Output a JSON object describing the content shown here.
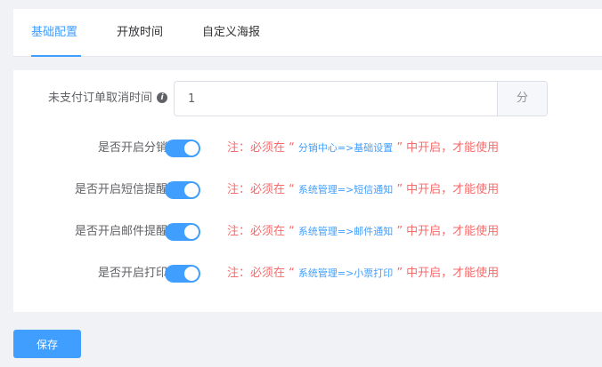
{
  "tabs": [
    {
      "label": "基础配置",
      "active": true
    },
    {
      "label": "开放时间",
      "active": false
    },
    {
      "label": "自定义海报",
      "active": false
    }
  ],
  "order_cancel": {
    "label": "未支付订单取消时间",
    "value": "1",
    "unit": "分"
  },
  "switches": [
    {
      "label": "是否开启分销",
      "on": true,
      "note_prefix": "注：必须在 “",
      "note_path": "分销中心=>基础设置",
      "note_suffix": "” 中开启，才能使用"
    },
    {
      "label": "是否开启短信提醒",
      "on": true,
      "note_prefix": "注：必须在 “",
      "note_path": "系统管理=>短信通知",
      "note_suffix": "” 中开启，才能使用"
    },
    {
      "label": "是否开启邮件提醒",
      "on": true,
      "note_prefix": "注：必须在 “",
      "note_path": "系统管理=>邮件通知",
      "note_suffix": "” 中开启，才能使用"
    },
    {
      "label": "是否开启打印",
      "on": true,
      "note_prefix": "注：必须在 “",
      "note_path": "系统管理=>小票打印",
      "note_suffix": "” 中开启，才能使用"
    }
  ],
  "save_label": "保存",
  "colors": {
    "accent": "#409eff",
    "note": "#f56c6c"
  }
}
